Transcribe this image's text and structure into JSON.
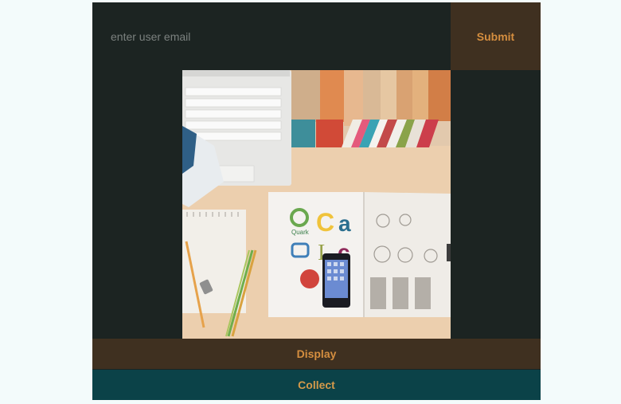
{
  "email": {
    "placeholder": "enter user email",
    "value": ""
  },
  "buttons": {
    "submit_label": "Submit",
    "display_label": "Display",
    "collect_label": "Collect"
  },
  "photo": {
    "icon": "workspace-photo-icon",
    "logo_texts": [
      "Quark"
    ]
  },
  "colors": {
    "panel": "#1c2422",
    "accent_brown": "#3f3020",
    "accent_teal": "#0b4248",
    "label_orange": "#d58e3f"
  }
}
